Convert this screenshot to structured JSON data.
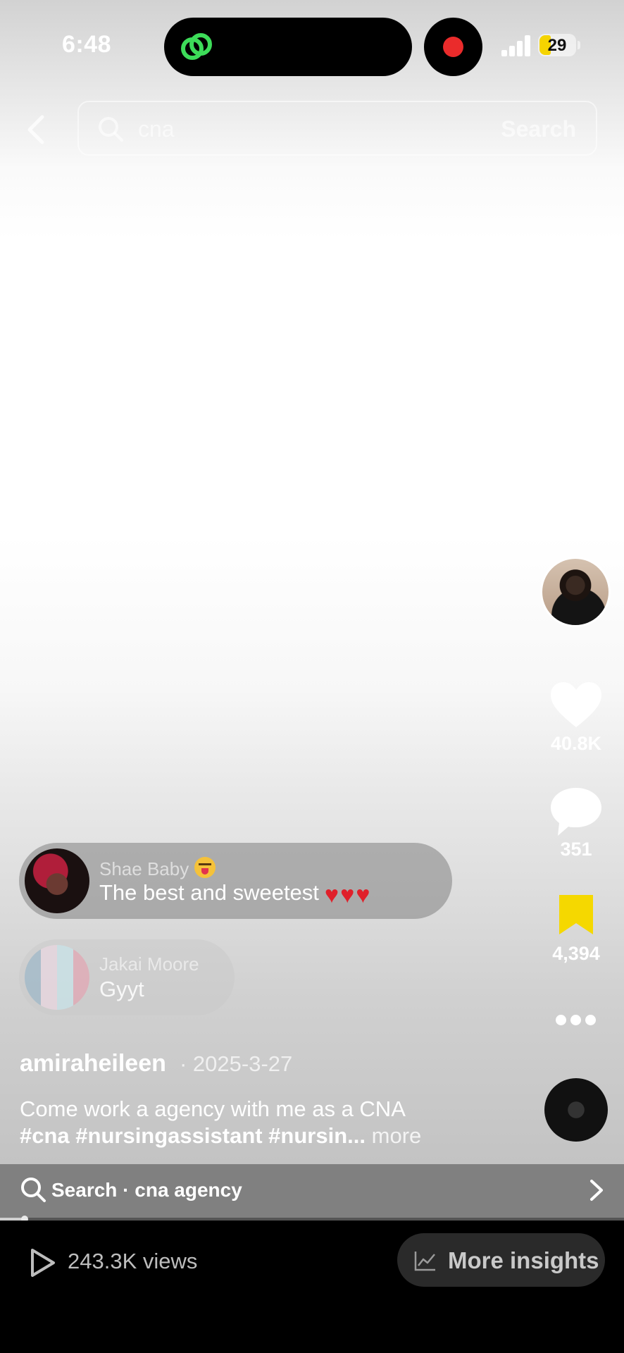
{
  "status_bar": {
    "time": "6:48",
    "battery": "29"
  },
  "top_search": {
    "query": "cna",
    "button": "Search"
  },
  "rail": {
    "likes": "40.8K",
    "comments": "351",
    "saves": "4,394"
  },
  "comments": [
    {
      "name": "Shae Baby",
      "text": "The best and sweetest"
    },
    {
      "name": "Jakai Moore",
      "text": "Gyyt"
    }
  ],
  "post": {
    "author": "amiraheileen",
    "date": "· 2025-3-27",
    "caption_line1": "Come work a agency with me as a CNA",
    "caption_line2": "#cna #nursingassistant #nursin...",
    "more": "more"
  },
  "related_search": {
    "label": "Search · cna agency"
  },
  "playback": {
    "progress": 0.04
  },
  "footer": {
    "views": "243.3K views",
    "insights": "More insights"
  },
  "colors": {
    "save_icon": "#f5d800",
    "record": "#ea2b2b",
    "island_icon": "#3ddc59"
  }
}
